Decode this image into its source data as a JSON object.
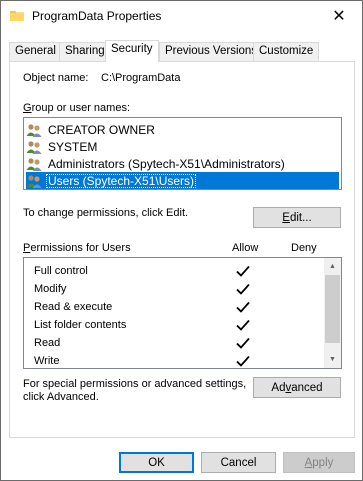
{
  "window": {
    "title": "ProgramData Properties",
    "close_glyph": "✕"
  },
  "tabs": [
    {
      "label": "General",
      "active": false
    },
    {
      "label": "Sharing",
      "active": false
    },
    {
      "label": "Security",
      "active": true
    },
    {
      "label": "Previous Versions",
      "active": false
    },
    {
      "label": "Customize",
      "active": false
    }
  ],
  "object": {
    "label": "Object name:",
    "value": "C:\\ProgramData"
  },
  "groups": {
    "label_prefix": "",
    "label_accel": "G",
    "label_rest": "roup or user names:",
    "items": [
      {
        "name": "CREATOR OWNER",
        "icon": "user-group-icon",
        "selected": false
      },
      {
        "name": "SYSTEM",
        "icon": "user-group-icon",
        "selected": false
      },
      {
        "name": "Administrators (Spytech-X51\\Administrators)",
        "icon": "user-group-icon",
        "selected": false
      },
      {
        "name": "Users (Spytech-X51\\Users)",
        "icon": "user-group-icon",
        "selected": true
      }
    ]
  },
  "change": {
    "text": "To change permissions, click Edit.",
    "edit_accel": "E",
    "edit_rest": "dit..."
  },
  "permissions": {
    "label_accel": "P",
    "label_rest": "ermissions for Users",
    "allow_header": "Allow",
    "deny_header": "Deny",
    "rows": [
      {
        "name": "Full control",
        "allow": true,
        "deny": false
      },
      {
        "name": "Modify",
        "allow": true,
        "deny": false
      },
      {
        "name": "Read & execute",
        "allow": true,
        "deny": false
      },
      {
        "name": "List folder contents",
        "allow": true,
        "deny": false
      },
      {
        "name": "Read",
        "allow": true,
        "deny": false
      },
      {
        "name": "Write",
        "allow": true,
        "deny": false
      }
    ],
    "scroll_up_glyph": "▲",
    "scroll_down_glyph": "▼"
  },
  "special": {
    "line1": "For special permissions or advanced settings,",
    "line2": "click Advanced.",
    "adv_prefix": "Ad",
    "adv_accel": "v",
    "adv_rest": "anced"
  },
  "footer": {
    "ok": "OK",
    "cancel": "Cancel",
    "apply_accel": "A",
    "apply_rest": "pply"
  },
  "colors": {
    "selection": "#0078d7",
    "folder": "#f5c342"
  }
}
